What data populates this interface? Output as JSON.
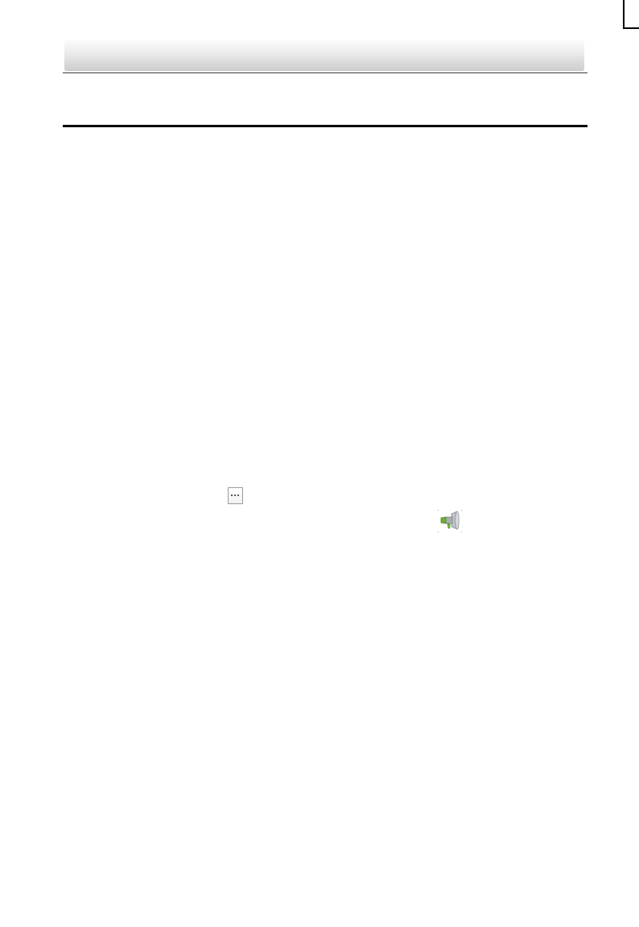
{
  "page": {
    "header_bar_color": "#e4e4e4",
    "rule_color": "#000000"
  },
  "icons": {
    "more": "more-options-icon",
    "speaker": "speaker-icon"
  }
}
